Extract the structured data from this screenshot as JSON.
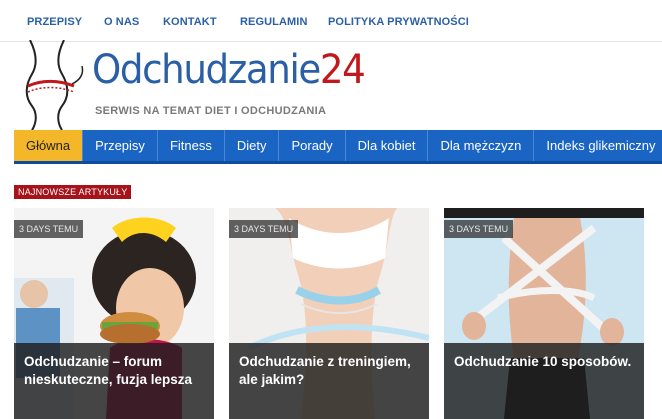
{
  "top_nav": [
    "PRZEPISY",
    "O NAS",
    "KONTAKT",
    "REGULAMIN",
    "POLITYKA PRYWATNOŚCI"
  ],
  "logo": {
    "name": "Odchudzanie",
    "number": "24"
  },
  "tagline": "SERWIS NA TEMAT DIET I ODCHUDZANIA",
  "main_nav": [
    "Główna",
    "Przepisy",
    "Fitness",
    "Diety",
    "Porady",
    "Dla kobiet",
    "Dla mężczyzn",
    "Indeks glikemiczny"
  ],
  "main_nav_active": "Główna",
  "section_title": "NAJNOWSZE ARTYKUŁY",
  "articles": [
    {
      "badge": "3 DAYS TEMU",
      "title": "Odchudzanie – forum nieskuteczne, fuzja lepsza"
    },
    {
      "badge": "3 DAYS TEMU",
      "title": "Odchudzanie z treningiem, ale jakim?"
    },
    {
      "badge": "3 DAYS TEMU",
      "title": "Odchudzanie 10 sposobów."
    }
  ],
  "colors": {
    "brand_blue": "#1a64c4",
    "accent_red": "#a6131a",
    "active_tab": "#f5b72a"
  }
}
